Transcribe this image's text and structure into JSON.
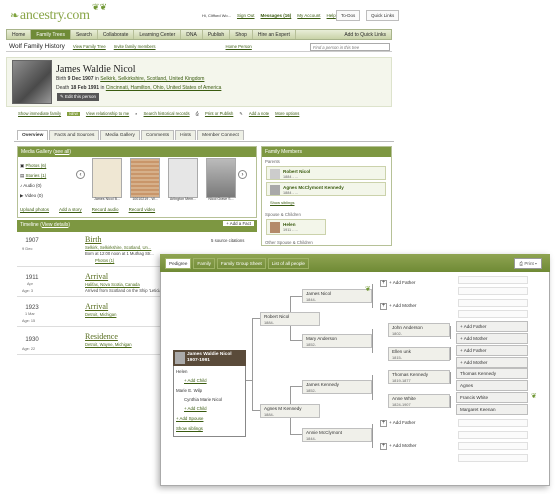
{
  "header": {
    "logo_text": "ancestry.com",
    "greeting": "Hi, Clifford Wo...",
    "sign_out": "Sign Out",
    "messages": "Messages (16)",
    "my_account": "My Account",
    "help": "Help",
    "to_dos": "To-Dos",
    "quick_links": "Quick Links"
  },
  "nav": {
    "items": [
      "Home",
      "Family Trees",
      "Search",
      "Collaborate",
      "Learning Center",
      "DNA",
      "Publish",
      "Shop",
      "Hire an Expert"
    ],
    "active": "Family Trees",
    "add_quick_links": "Add to Quick Links"
  },
  "subnav": {
    "tree_title": "Wolf Family History",
    "view_family_tree": "View Family Tree",
    "invite": "Invite family members",
    "home_person": "Home Person",
    "find_placeholder": "Find a person in this tree"
  },
  "person": {
    "name": "James Waldie Nicol",
    "birth_label": "Birth",
    "birth_date": "9 Dec 1907",
    "birth_in": "in",
    "birth_place": "Selkirk, Selkirkshire, Scotland, United Kingdom",
    "death_label": "Death",
    "death_date": "18 Feb 1991",
    "death_in": "in",
    "death_place": "Cincinnati, Hamilton, Ohio, United States of America",
    "edit_button": "Edit this person"
  },
  "actions": {
    "show_immediate": "Show immediate family",
    "new_badge": "NEW",
    "view_relationship": "View relationship to me",
    "search_records": "Search historical records",
    "print_publish": "Print or Publish",
    "add_note": "Add a note",
    "more_options": "More options"
  },
  "tabs": [
    "Overview",
    "Facts and Sources",
    "Media Gallery",
    "Comments",
    "Hints",
    "Member Connect"
  ],
  "media_gallery": {
    "title": "Media Gallery",
    "see_all": "see all",
    "side": [
      "Photos (6)",
      "Stories (1)",
      "Audio (0)",
      "Video (0)"
    ],
    "thumbs": [
      "James Nicol B...",
      "10010219 - W...",
      "Arlington Mem...",
      "Nicol Grave S..."
    ],
    "upload": "Upload photos",
    "add_story": "Add a story",
    "record_audio": "Record audio",
    "record_video": "Record video"
  },
  "timeline": {
    "title": "Timeline",
    "view_details": "View details",
    "add_fact": "Add a Fact",
    "sources": "5 source citations",
    "events": [
      {
        "year": "1907",
        "date": "9 Dec",
        "age": "",
        "title": "Birth",
        "place": "Selkirk, Selkirkshire, Scotland, Un...",
        "desc": "Born at 12:00 noon at 1 Muthag Str...",
        "photos": "Photos (1)"
      },
      {
        "year": "1911",
        "date": "Apr",
        "age": "Age: 3",
        "title": "Arrival",
        "place": "Halifax, Nova Scotia, Canada",
        "desc": "Arrived from Scotland on the Ship 'Leticia'",
        "photos": ""
      },
      {
        "year": "1923",
        "date": "1 Mar",
        "age": "Age: 15",
        "title": "Arrival",
        "place": "Detroit, Michigan",
        "desc": "",
        "photos": ""
      },
      {
        "year": "1930",
        "date": "",
        "age": "Age: 22",
        "title": "Residence",
        "place": "Detroit, Wayne, Michigan",
        "desc": "",
        "photos": ""
      }
    ]
  },
  "family_members": {
    "title": "Family Members",
    "parents_label": "Parents",
    "father": "Robert Nicol",
    "father_dates": "1884 - ...",
    "mother": "Agnes McClymont Kennedy",
    "mother_dates": "1884 - ...",
    "show_siblings": "Show siblings",
    "spouse_label": "Spouse & Children",
    "spouse": "Helen",
    "spouse_dates": "1911 - ...",
    "other_spouse_label": "Other Spouse & Children"
  },
  "pedigree": {
    "tabs": [
      "Pedigree",
      "Family",
      "Family Group Sheet",
      "List of all people"
    ],
    "active_tab": "Pedigree",
    "print": "Print",
    "focus_name": "James Waldie Nicol",
    "focus_dates": "1907-1991",
    "focus_list": [
      "Helen",
      "+ Add Child",
      "Marie E. Wilp",
      "Cynthia Marie Nicol",
      "+ Add Child",
      "+ Add Spouse",
      "Show siblings"
    ],
    "parents": [
      {
        "name": "Robert Nicol",
        "dates": "1884-"
      },
      {
        "name": "Agnes M Kennedy",
        "dates": "1884-"
      }
    ],
    "grandparents": [
      {
        "name": "James Nicol",
        "dates": "1844-"
      },
      {
        "name": "Mary Anderson",
        "dates": "1852-"
      },
      {
        "name": "James Kennedy",
        "dates": "1852-"
      },
      {
        "name": "Annie McClymont",
        "dates": "1844-"
      }
    ],
    "gg": [
      {
        "name": "+ Add Father",
        "dates": ""
      },
      {
        "name": "+ Add Mother",
        "dates": ""
      },
      {
        "name": "John Anderson",
        "dates": "1802-"
      },
      {
        "name": "Ellen unk",
        "dates": "1815-"
      },
      {
        "name": "Thomas Kennedy",
        "dates": "1819-1877"
      },
      {
        "name": "Anne White",
        "dates": "1824-1907"
      },
      {
        "name": "+ Add Father",
        "dates": ""
      },
      {
        "name": "+ Add Mother",
        "dates": ""
      }
    ],
    "ggg": [
      "",
      "",
      "",
      "",
      "+ Add Father",
      "+ Add Mother",
      "+ Add Father",
      "+ Add Mother",
      "Thomas Kennedy",
      "Agnes",
      "Francis White",
      "Margaret Keenan",
      "",
      "",
      "",
      ""
    ]
  }
}
